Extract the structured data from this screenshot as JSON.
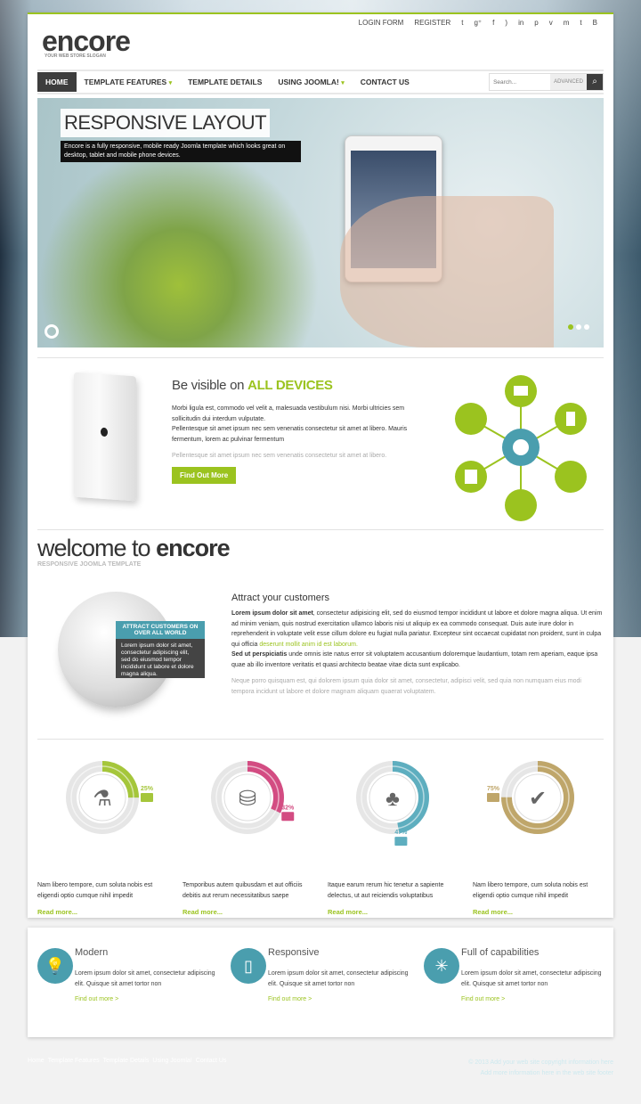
{
  "header": {
    "logo": "encore",
    "slogan": "YOUR WEB STORE SLOGAN",
    "top_links": [
      "LOGIN FORM",
      "REGISTER"
    ],
    "social_icons": [
      "twitter-icon",
      "google-plus-icon",
      "facebook-icon",
      "rss-icon",
      "linkedin-icon",
      "pinterest-icon",
      "vimeo-icon",
      "myspace-icon",
      "tumblr-icon",
      "blogger-icon"
    ]
  },
  "nav": {
    "items": [
      {
        "label": "HOME",
        "active": true
      },
      {
        "label": "TEMPLATE FEATURES",
        "caret": true
      },
      {
        "label": "TEMPLATE DETAILS"
      },
      {
        "label": "USING JOOMLA!",
        "caret": true
      },
      {
        "label": "CONTACT US"
      }
    ],
    "search_placeholder": "Search...",
    "advanced": "ADVANCED"
  },
  "hero": {
    "title": "RESPONSIVE LAYOUT",
    "desc": "Encore is a fully responsive, mobile ready Joomla template which looks great on desktop, tablet and mobile phone devices.",
    "slides": 3,
    "active_slide": 1
  },
  "devices": {
    "title_light": "Be visible on ",
    "title_bold": "ALL DEVICES",
    "p1": "Morbi ligula est, commodo vel velit a, malesuada vestibulum nisi. Morbi ultricies sem sollicitudin dui interdum vulputate.",
    "p2": "Pellentesque sit amet ipsum nec sem venenatis consectetur sit amet at libero. Mauris fermentum, lorem ac pulvinar fermentum",
    "p3": "Pellentesque sit amet ipsum nec sem venenatis consectetur sit amet at libero.",
    "button": "Find Out More"
  },
  "welcome": {
    "light": "welcome to ",
    "bold": "encore",
    "sub": "RESPONSIVE JOOMLA TEMPLATE",
    "globe_title": "ATTRACT CUSTOMERS ON OVER ALL WORLD",
    "globe_text": "Lorem ipsum dolor sit amet, consectetur adipiscing elit, sed do eiusmod tempor incididunt ut labore et dolore magna aliqua.",
    "heading": "Attract your customers",
    "b1": "Lorem ipsum dolor sit amet",
    "t1": ", consectetur adipisicing elit, sed do eiusmod tempor incididunt ut labore et dolore magna aliqua. Ut enim ad minim veniam, quis nostrud exercitation ullamco laboris nisi ut aliquip ex ea commodo consequat. Duis aute irure dolor in reprehenderit in voluptate velit esse cillum dolore eu fugiat nulla pariatur. Excepteur sint occaecat cupidatat non proident, sunt in culpa qui officia ",
    "link1": "deserunt mollit anim id est laborum.",
    "b2": "Sed ut perspiciatis",
    "t2": " unde omnis iste natus error sit voluptatem accusantium doloremque laudantium, totam rem aperiam, eaque ipsa quae ab illo inventore veritatis et quasi architecto beatae vitae dicta sunt explicabo.",
    "grey": "Neque porro quisquam est, qui dolorem ipsum quia dolor sit amet, consectetur, adipisci velit, sed quia non numquam eius modi tempora incidunt ut labore et dolore magnam aliquam quaerat voluptatem."
  },
  "stats": [
    {
      "percent": 25,
      "label": "25%",
      "color": "#a5c63b",
      "icon": "flask-icon",
      "text": "Nam libero tempore, cum soluta nobis est eligendi optio cumque nihil impedit",
      "link": "Read more..."
    },
    {
      "percent": 32,
      "label": "32%",
      "color": "#d34c82",
      "icon": "database-icon",
      "text": "Temporibus autem quibusdam et aut officiis debitis aut rerum necessitatibus saepe",
      "link": "Read more..."
    },
    {
      "percent": 47,
      "label": "47%",
      "color": "#5eaebf",
      "icon": "tree-icon",
      "text": "Itaque earum rerum hic tenetur a sapiente delectus, ut aut reiciendis voluptatibus",
      "link": "Read more..."
    },
    {
      "percent": 75,
      "label": "75%",
      "color": "#bfa66a",
      "icon": "badge-check-icon",
      "text": "Nam libero tempore, cum soluta nobis est eligendi optio cumque nihil impedit",
      "link": "Read more..."
    }
  ],
  "features": [
    {
      "title": "Modern",
      "icon": "lightbulb-icon",
      "text": "Lorem ipsum dolor sit amet, consectetur adipiscing elit. Quisque sit amet tortor non",
      "link": "Find out more >"
    },
    {
      "title": "Responsive",
      "icon": "tablet-icon",
      "text": "Lorem ipsum dolor sit amet, consectetur adipiscing elit. Quisque sit amet tortor non",
      "link": "Find out more >"
    },
    {
      "title": "Full of capabilities",
      "icon": "spinner-icon",
      "text": "Lorem ipsum dolor sit amet, consectetur adipiscing elit. Quisque sit amet tortor non",
      "link": "Find out more >"
    }
  ],
  "footer": {
    "links": [
      "Home",
      "Template Features",
      "Template Details",
      "Using Joomla!",
      "Contact Us"
    ],
    "copyright": "© 2013 Add your web site copyright information here",
    "info": "Add more information here in the web site footer"
  },
  "colors": {
    "accent": "#9bc31f",
    "teal": "#4a9eae",
    "dark": "#3d3d3d"
  }
}
